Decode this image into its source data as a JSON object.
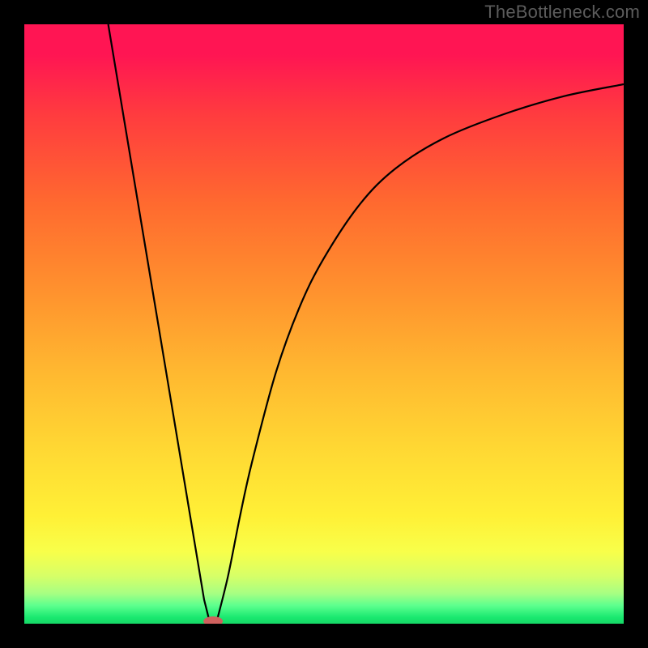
{
  "watermark": "TheBottleneck.com",
  "chart_data": {
    "type": "line",
    "title": "",
    "xlabel": "",
    "ylabel": "",
    "xlim": [
      0,
      100
    ],
    "ylim": [
      0,
      100
    ],
    "grid": false,
    "legend": false,
    "background": "rainbow-gradient-vertical",
    "series": [
      {
        "name": "left-branch",
        "x": [
          14,
          16,
          18,
          20,
          22,
          24,
          26,
          28,
          30,
          31
        ],
        "y": [
          100,
          88,
          76,
          64,
          52,
          40,
          28,
          16,
          4,
          0
        ]
      },
      {
        "name": "right-branch",
        "x": [
          32,
          34,
          36,
          38,
          42,
          46,
          50,
          56,
          62,
          70,
          80,
          90,
          100
        ],
        "y": [
          0,
          8,
          18,
          27,
          42,
          53,
          61,
          70,
          76,
          81,
          85,
          88,
          90
        ]
      }
    ],
    "minimum_point": {
      "x": 31.5,
      "y": 0
    },
    "annotations": []
  },
  "colors": {
    "curve": "#000000",
    "marker": "#cf615e",
    "frame": "#000000"
  }
}
